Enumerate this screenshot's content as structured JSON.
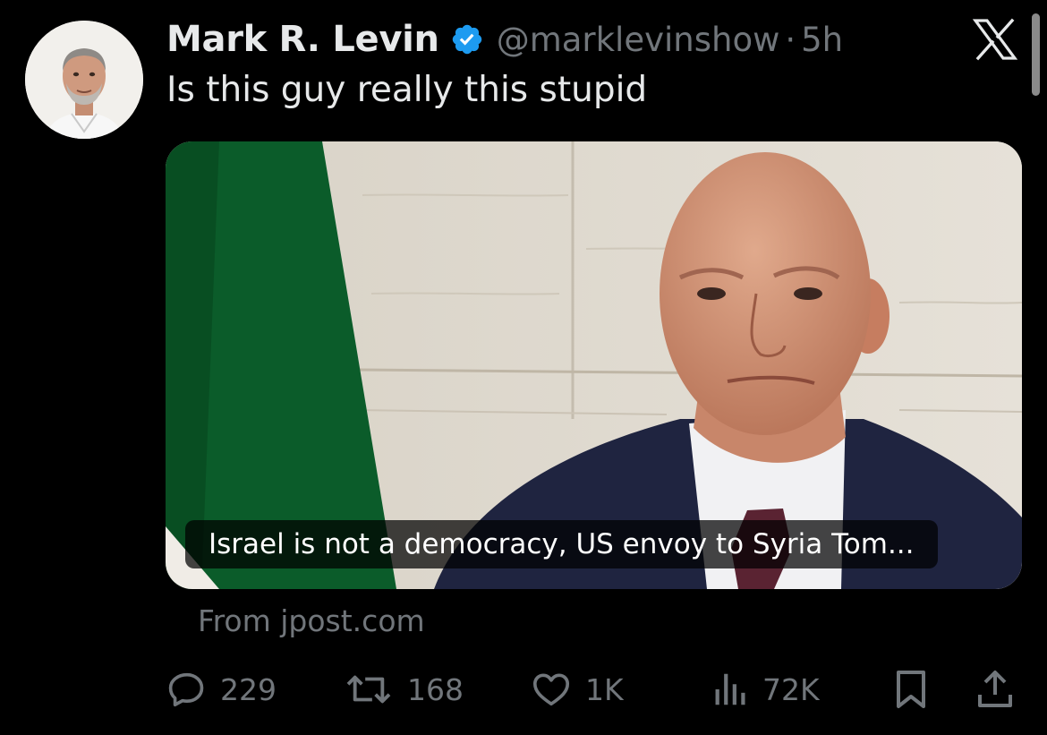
{
  "author": {
    "display_name": "Mark R. Levin",
    "handle": "@marklevinshow",
    "separator": "·",
    "time": "5h",
    "verified_color": "#1d9bf0"
  },
  "tweet": {
    "text": "Is this guy really this stupid"
  },
  "card": {
    "headline": "Israel is not a democracy, US envoy to Syria Tom...",
    "source": "From jpost.com"
  },
  "actions": {
    "replies": "229",
    "reposts": "168",
    "likes": "1K",
    "views": "72K"
  },
  "icons": {
    "logo": "x-logo-icon",
    "reply": "reply-icon",
    "repost": "repost-icon",
    "like": "heart-icon",
    "views": "views-chart-icon",
    "bookmark": "bookmark-icon",
    "share": "share-icon",
    "verified": "verified-badge-icon"
  }
}
